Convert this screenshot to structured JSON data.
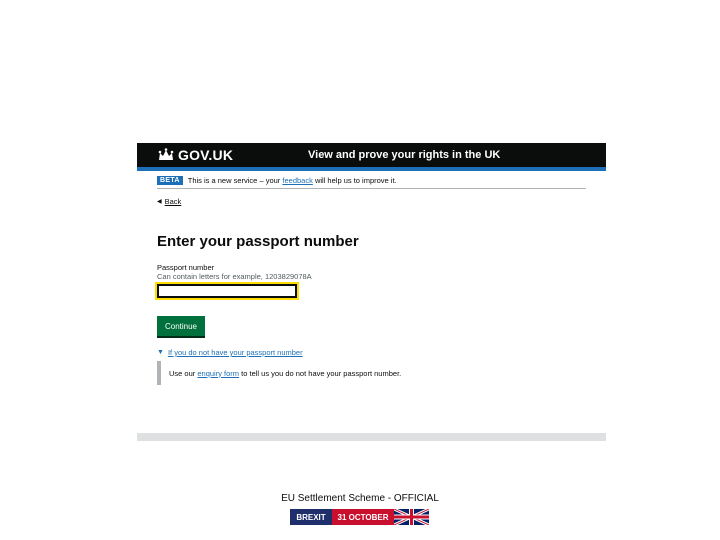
{
  "header": {
    "logo_text": "GOV.UK",
    "service_name": "View and prove your rights in the UK"
  },
  "phase_banner": {
    "tag": "BETA",
    "text_before": "This is a new service – your",
    "feedback_link": "feedback",
    "text_after": "will help us to improve it."
  },
  "back_link": "Back",
  "main": {
    "heading": "Enter your passport number",
    "field_label": "Passport number",
    "field_hint": "Can contain letters for example, 1203829078A",
    "field_value": "",
    "continue_label": "Continue"
  },
  "details": {
    "summary": "If you do not have your passport number",
    "body_before": "Use our",
    "body_link": "enquiry form",
    "body_after": "to tell us you do not have your passport number."
  },
  "slide_footer": {
    "text": "EU Settlement Scheme - OFFICIAL",
    "banner_left": "BREXIT",
    "banner_right": "31 OCTOBER"
  },
  "colors": {
    "header_bg": "#0b0c0c",
    "link": "#1d70b8",
    "button": "#00703c",
    "focus": "#ffdd00"
  }
}
